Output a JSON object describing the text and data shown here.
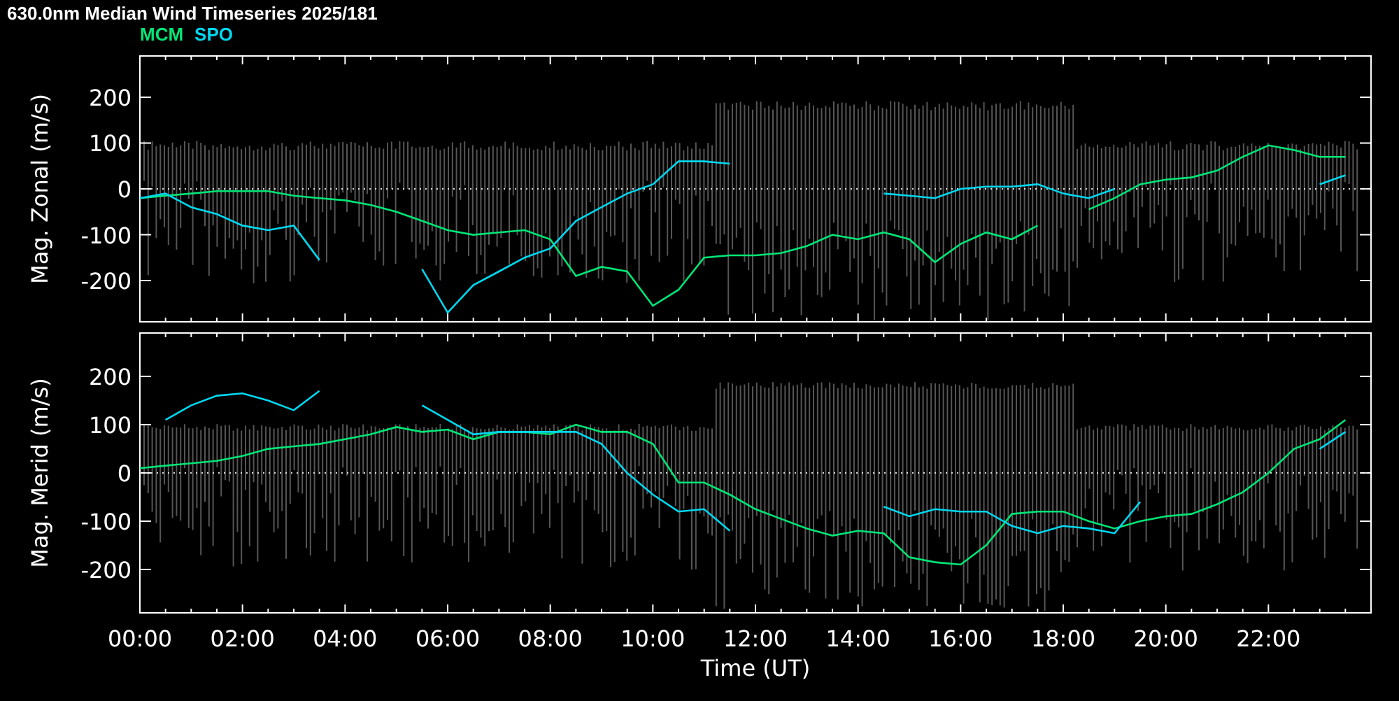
{
  "title": "630.0nm  Median Wind Timeseries 2025/181",
  "panels": [
    {
      "chart_data": {
        "type": "line",
        "ylabel": "Mag. Zonal (m/s)",
        "grid": true,
        "x": [
          0,
          0.5,
          1,
          1.5,
          2,
          2.5,
          3,
          3.5,
          4,
          4.5,
          5,
          5.5,
          6,
          6.5,
          7,
          7.5,
          8,
          8.5,
          9,
          9.5,
          10,
          10.5,
          11,
          11.5,
          12,
          12.5,
          13,
          13.5,
          14,
          14.5,
          15,
          15.5,
          16,
          16.5,
          17,
          17.5,
          18,
          18.5,
          19,
          19.5,
          20,
          20.5,
          21,
          21.5,
          22,
          22.5,
          23,
          23.5
        ],
        "xlim": [
          0,
          24
        ],
        "ylim": [
          -290,
          290
        ],
        "yticks": [
          -200,
          -100,
          0,
          100,
          200
        ],
        "series": [
          {
            "name": "MCM",
            "color": "#00e676",
            "values": [
              -20,
              -15,
              -10,
              -5,
              -5,
              -5,
              -15,
              -20,
              -25,
              -35,
              -50,
              -70,
              -90,
              -100,
              -95,
              -90,
              -110,
              -190,
              -170,
              -180,
              -255,
              -220,
              -150,
              -145,
              -145,
              -140,
              -125,
              -100,
              -110,
              -95,
              -110,
              -160,
              -120,
              -95,
              -110,
              -80,
              null,
              -45,
              -20,
              10,
              20,
              25,
              40,
              70,
              95,
              85,
              70,
              70
            ]
          },
          {
            "name": "SPO",
            "color": "#00d8f0",
            "values": [
              -20,
              -10,
              -40,
              -55,
              -80,
              -90,
              -80,
              -155,
              null,
              null,
              null,
              -175,
              -270,
              -210,
              -180,
              -150,
              -130,
              -70,
              -40,
              -10,
              10,
              60,
              60,
              55,
              null,
              null,
              null,
              null,
              null,
              -10,
              -15,
              -20,
              0,
              5,
              5,
              10,
              -10,
              -20,
              0,
              null,
              null,
              null,
              null,
              null,
              null,
              null,
              10,
              30
            ]
          }
        ]
      }
    },
    {
      "chart_data": {
        "type": "line",
        "ylabel": "Mag. Merid (m/s)",
        "grid": true,
        "xlabel": "Time (UT)",
        "x": [
          0,
          0.5,
          1,
          1.5,
          2,
          2.5,
          3,
          3.5,
          4,
          4.5,
          5,
          5.5,
          6,
          6.5,
          7,
          7.5,
          8,
          8.5,
          9,
          9.5,
          10,
          10.5,
          11,
          11.5,
          12,
          12.5,
          13,
          13.5,
          14,
          14.5,
          15,
          15.5,
          16,
          16.5,
          17,
          17.5,
          18,
          18.5,
          19,
          19.5,
          20,
          20.5,
          21,
          21.5,
          22,
          22.5,
          23,
          23.5
        ],
        "xlim": [
          0,
          24
        ],
        "ylim": [
          -290,
          290
        ],
        "yticks": [
          -200,
          -100,
          0,
          100,
          200
        ],
        "xticks": [
          {
            "value": 0,
            "label": "00:00"
          },
          {
            "value": 2,
            "label": "02:00"
          },
          {
            "value": 4,
            "label": "04:00"
          },
          {
            "value": 6,
            "label": "06:00"
          },
          {
            "value": 8,
            "label": "08:00"
          },
          {
            "value": 10,
            "label": "10:00"
          },
          {
            "value": 12,
            "label": "12:00"
          },
          {
            "value": 14,
            "label": "14:00"
          },
          {
            "value": 16,
            "label": "16:00"
          },
          {
            "value": 18,
            "label": "18:00"
          },
          {
            "value": 20,
            "label": "20:00"
          },
          {
            "value": 22,
            "label": "22:00"
          }
        ],
        "series": [
          {
            "color": "#00e676",
            "values": [
              10,
              15,
              20,
              25,
              35,
              50,
              55,
              60,
              70,
              80,
              95,
              85,
              90,
              70,
              85,
              85,
              80,
              100,
              85,
              85,
              60,
              -20,
              -20,
              -45,
              -75,
              -95,
              -115,
              -130,
              -120,
              -125,
              -175,
              -185,
              -190,
              -150,
              -85,
              -80,
              -80,
              -100,
              -115,
              -100,
              -90,
              -85,
              -65,
              -40,
              0,
              50,
              70,
              110
            ]
          },
          {
            "color": "#00d8f0",
            "values": [
              null,
              110,
              140,
              160,
              165,
              150,
              130,
              170,
              null,
              null,
              null,
              140,
              110,
              80,
              85,
              85,
              85,
              85,
              60,
              0,
              -45,
              -80,
              -75,
              -120,
              null,
              null,
              null,
              null,
              null,
              -70,
              -90,
              -75,
              -80,
              -80,
              -110,
              -125,
              -110,
              -115,
              -125,
              -60,
              null,
              null,
              null,
              null,
              null,
              null,
              50,
              85
            ]
          }
        ]
      }
    }
  ]
}
